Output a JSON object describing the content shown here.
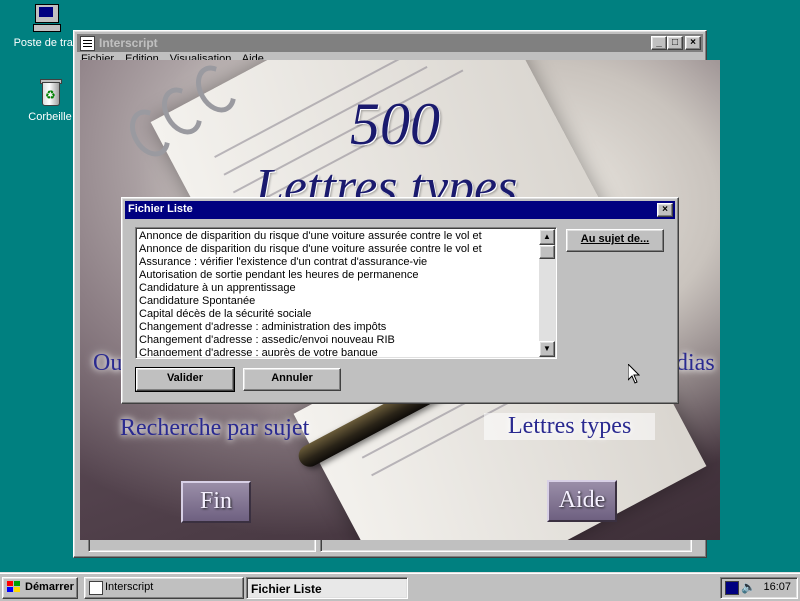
{
  "desktop": {
    "icons": [
      {
        "label": "Poste de trav"
      },
      {
        "label": "Corbeille"
      }
    ]
  },
  "app_window": {
    "title": "Interscript",
    "menu": [
      "Fichier",
      "Edition",
      "Visualisation",
      "Aide"
    ],
    "controls": {
      "minimize": "_",
      "maximize": "□",
      "close": "×"
    }
  },
  "splash": {
    "title_number": "500",
    "title_text": "Lettres types",
    "left_partial": "Ou",
    "right_partial": "dias",
    "search_label": "Recherche par sujet",
    "letters_label": "Lettres types",
    "exit_button": "Fin",
    "help_button": "Aide"
  },
  "dialog": {
    "title": "Fichier Liste",
    "close": "×",
    "items": [
      "Annonce de disparition du risque d'une voiture assurée contre le vol et",
      "Annonce de disparition du risque d'une voiture assurée contre le vol et",
      "Assurance : vérifier l'existence d'un contrat d'assurance-vie",
      "Autorisation de sortie pendant les heures de permanence",
      "Candidature à un apprentissage",
      "Candidature Spontanée",
      "Capital décès de la sécurité sociale",
      "Changement d'adresse : administration des impôts",
      "Changement d'adresse : assedic/envoi nouveau RIB",
      "Changement d'adresse : auprès de votre banque"
    ],
    "about_button": "Au sujet de...",
    "ok_button": "Valider",
    "cancel_button": "Annuler",
    "scroll_up": "▲",
    "scroll_down": "▼"
  },
  "taskbar": {
    "start_label": "Démarrer",
    "tasks": [
      "Interscript",
      "Fichier Liste"
    ],
    "clock": "16:07"
  }
}
